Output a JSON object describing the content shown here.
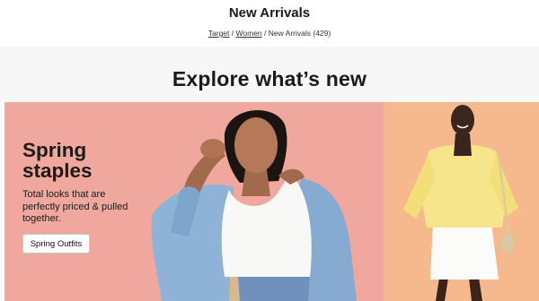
{
  "header": {
    "title": "New Arrivals",
    "breadcrumb": {
      "items": [
        "Target",
        "Women"
      ],
      "current": "New Arrivals (429)",
      "separator": "/"
    }
  },
  "explore": {
    "heading": "Explore what’s new"
  },
  "promo": {
    "title": "Spring staples",
    "text": "Total looks that are perfectly priced & pulled together.",
    "button_label": "Spring Outfits"
  },
  "colors": {
    "promo_background": "#f0a79d",
    "secondary_background": "#f5b98d",
    "band_background": "#f7f7f7"
  }
}
